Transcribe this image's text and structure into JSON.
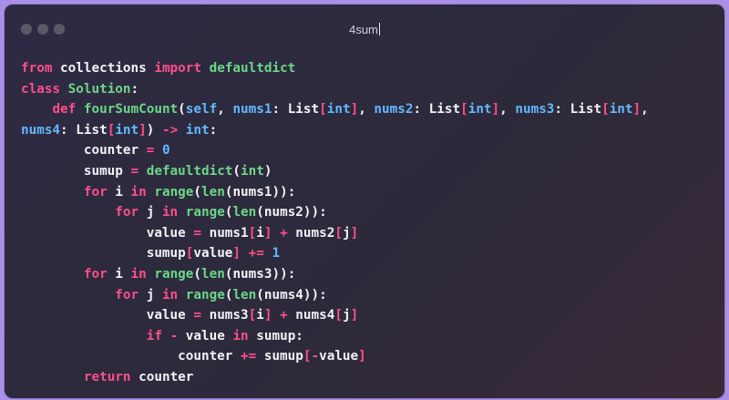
{
  "window": {
    "title": "4sum",
    "background_color": "#a98fe6",
    "traffic_light_color": "#5a5a66"
  },
  "code": {
    "language": "python",
    "lines": [
      "from collections import defaultdict",
      "class Solution:",
      "    def fourSumCount(self, nums1: List[int], nums2: List[int], nums3: List[int],",
      "nums4: List[int]) -> int:",
      "        counter = 0",
      "        sumup = defaultdict(int)",
      "        for i in range(len(nums1)):",
      "            for j in range(len(nums2)):",
      "                value = nums1[i] + nums2[j]",
      "                sumup[value] += 1",
      "        for i in range(len(nums3)):",
      "            for j in range(len(nums4)):",
      "                value = nums3[i] + nums4[j]",
      "                if - value in sumup:",
      "                    counter += sumup[-value]",
      "        return counter"
    ]
  }
}
